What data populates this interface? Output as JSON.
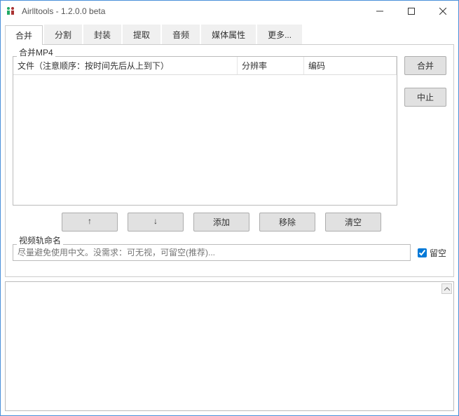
{
  "title": "Airlltools  -  1.2.0.0 beta",
  "tabs": [
    "合并",
    "分割",
    "封装",
    "提取",
    "音频",
    "媒体属性",
    "更多..."
  ],
  "activeTab": 0,
  "section1Label": "合并MP4",
  "tableHeaders": {
    "file": "文件（注意顺序：按时间先后从上到下）",
    "resolution": "分辨率",
    "codec": "编码"
  },
  "buttons": {
    "merge": "合并",
    "stop": "中止",
    "up": "↑",
    "down": "↓",
    "add": "添加",
    "remove": "移除",
    "clear": "清空"
  },
  "section2Label": "视频轨命名",
  "trackName": {
    "placeholder": "尽量避免使用中文。没需求：可无视，可留空(推荐)...",
    "leaveBlankLabel": "留空",
    "leaveBlankChecked": true
  }
}
